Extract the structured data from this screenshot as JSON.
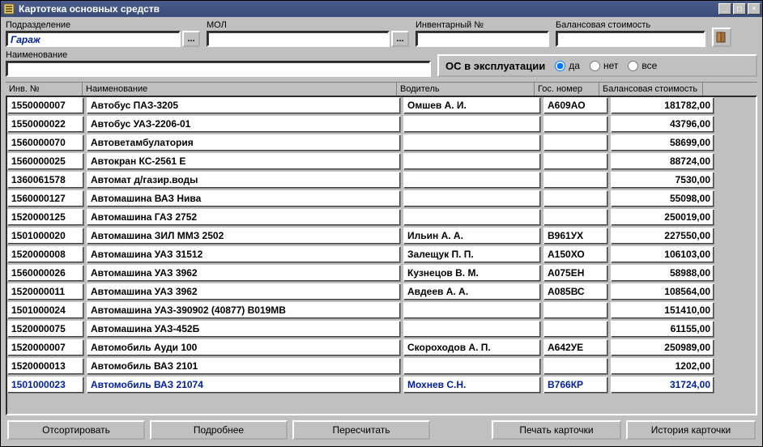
{
  "window": {
    "title": "Картотека основных средств"
  },
  "filters": {
    "subdivision_label": "Подразделение",
    "subdivision_value": "Гараж",
    "mol_label": "МОЛ",
    "mol_value": "",
    "inv_label": "Инвентарный №",
    "inv_value": "",
    "balance_label": "Балансовая стоимость",
    "balance_value": "",
    "name_label": "Наименование",
    "name_value": "",
    "dots": "..."
  },
  "status_panel": {
    "title": "ОС в эксплуатации",
    "opt_yes": "да",
    "opt_no": "нет",
    "opt_all": "все",
    "selected": "да"
  },
  "columns": {
    "inv": "Инв. №",
    "name": "Наименование",
    "driver": "Водитель",
    "gos": "Гос. номер",
    "balance": "Балансовая стоимость"
  },
  "rows": [
    {
      "inv": "1550000007",
      "name": "Автобус ПАЗ-3205",
      "driver": "Омшев А. И.",
      "gos": "А609АО",
      "bal": "181782,00"
    },
    {
      "inv": "1550000022",
      "name": "Автобус УАЗ-2206-01",
      "driver": "",
      "gos": "",
      "bal": "43796,00"
    },
    {
      "inv": "1560000070",
      "name": "Автоветамбулатория",
      "driver": "",
      "gos": "",
      "bal": "58699,00"
    },
    {
      "inv": "1560000025",
      "name": "Автокран КС-2561 Е",
      "driver": "",
      "gos": "",
      "bal": "88724,00"
    },
    {
      "inv": "1360061578",
      "name": "Автомат д/газир.воды",
      "driver": "",
      "gos": "",
      "bal": "7530,00"
    },
    {
      "inv": "1560000127",
      "name": "Автомашина ВАЗ Нива",
      "driver": "",
      "gos": "",
      "bal": "55098,00"
    },
    {
      "inv": "1520000125",
      "name": "Автомашина ГАЗ 2752",
      "driver": "",
      "gos": "",
      "bal": "250019,00"
    },
    {
      "inv": "1501000020",
      "name": "Автомашина ЗИЛ ММЗ 2502",
      "driver": "Ильин А. А.",
      "gos": "В961УХ",
      "bal": "227550,00"
    },
    {
      "inv": "1520000008",
      "name": "Автомашина УАЗ 31512",
      "driver": "Залещук П. П.",
      "gos": "А150ХО",
      "bal": "106103,00"
    },
    {
      "inv": "1560000026",
      "name": "Автомашина УАЗ 3962",
      "driver": "Кузнецов В. М.",
      "gos": "А075ЕН",
      "bal": "58988,00"
    },
    {
      "inv": "1520000011",
      "name": "Автомашина УАЗ 3962",
      "driver": "Авдеев А. А.",
      "gos": "А085ВС",
      "bal": "108564,00"
    },
    {
      "inv": "1501000024",
      "name": "Автомашина УАЗ-390902 (40877) В019МВ",
      "driver": "",
      "gos": "",
      "bal": "151410,00"
    },
    {
      "inv": "1520000075",
      "name": "Автомашина УАЗ-452Б",
      "driver": "",
      "gos": "",
      "bal": "61155,00"
    },
    {
      "inv": "1520000007",
      "name": "Автомобиль Ауди 100",
      "driver": "Скороходов А. П.",
      "gos": "А642УЕ",
      "bal": "250989,00"
    },
    {
      "inv": "1520000013",
      "name": "Автомобиль ВАЗ 2101",
      "driver": "",
      "gos": "",
      "bal": "1202,00"
    },
    {
      "inv": "1501000023",
      "name": "Автомобиль ВАЗ 21074",
      "driver": "Мохнев С.Н.",
      "gos": "В766КР",
      "bal": "31724,00"
    }
  ],
  "selected_row_index": 15,
  "footer": {
    "sort": "Отсортировать",
    "details": "Подробнее",
    "recalc": "Пересчитать",
    "print": "Печать карточки",
    "history": "История карточки"
  }
}
